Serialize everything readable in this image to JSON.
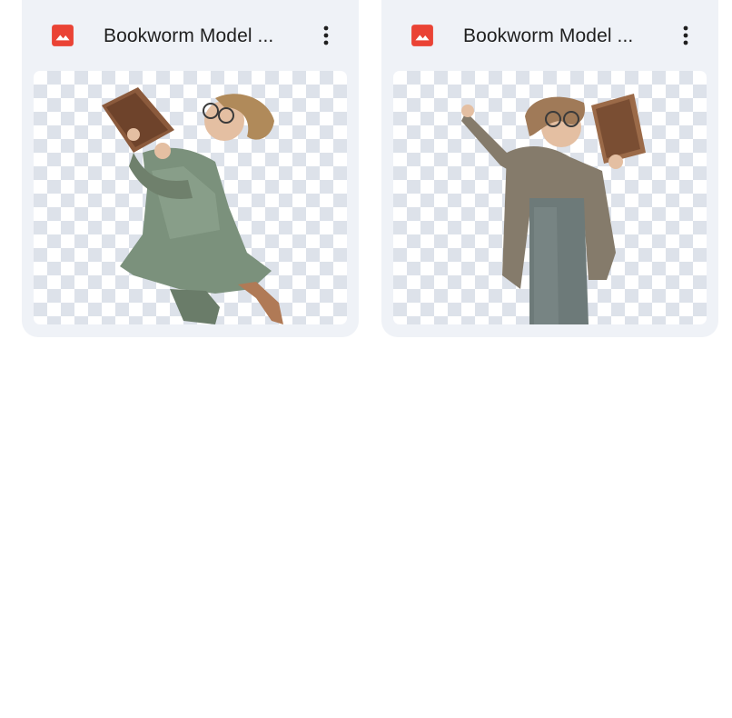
{
  "files": [
    {
      "title": "Bookworm Model ...",
      "icon": "image-icon",
      "icon_color": "#ea4335",
      "more_icon": "more-vert-icon"
    },
    {
      "title": "Bookworm Model ...",
      "icon": "image-icon",
      "icon_color": "#ea4335",
      "more_icon": "more-vert-icon"
    }
  ]
}
